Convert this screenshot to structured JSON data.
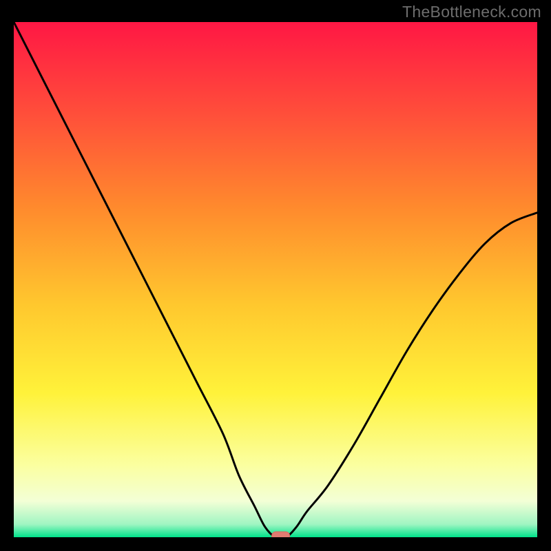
{
  "watermark": "TheBottleneck.com",
  "colors": {
    "bg": "#000000",
    "line": "#000000",
    "marker_fill": "#e07b71",
    "marker_stroke": "#d56a60",
    "watermark": "#6d6d6d",
    "gradient_top": "#ff1744",
    "gradient_upper": "#ff4f3a",
    "gradient_mid_up": "#ff8a2d",
    "gradient_mid": "#ffc82e",
    "gradient_mid_low": "#fff23a",
    "gradient_low": "#fbffa0",
    "gradient_band": "#f3ffd6",
    "gradient_green": "#00e38a"
  },
  "chart_data": {
    "type": "line",
    "title": "",
    "xlabel": "",
    "ylabel": "",
    "xlim": [
      0,
      100
    ],
    "ylim": [
      0,
      100
    ],
    "series": [
      {
        "name": "bottleneck-curve",
        "x": [
          0,
          5,
          10,
          15,
          20,
          25,
          30,
          35,
          40,
          43,
          46,
          48,
          50,
          52,
          54,
          56,
          60,
          65,
          70,
          75,
          80,
          85,
          90,
          95,
          100
        ],
        "values": [
          100,
          90,
          80,
          70,
          60,
          50,
          40,
          30,
          20,
          12,
          6,
          2,
          0,
          0,
          2,
          5,
          10,
          18,
          27,
          36,
          44,
          51,
          57,
          61,
          63
        ]
      }
    ],
    "marker": {
      "x": 51,
      "y": 0
    },
    "gradient_stops": [
      {
        "pos": 0.0,
        "color": "#ff1744"
      },
      {
        "pos": 0.18,
        "color": "#ff4f3a"
      },
      {
        "pos": 0.36,
        "color": "#ff8a2d"
      },
      {
        "pos": 0.55,
        "color": "#ffc82e"
      },
      {
        "pos": 0.72,
        "color": "#fff23a"
      },
      {
        "pos": 0.86,
        "color": "#fbffa0"
      },
      {
        "pos": 0.93,
        "color": "#f3ffd6"
      },
      {
        "pos": 0.975,
        "color": "#9ff5c2"
      },
      {
        "pos": 1.0,
        "color": "#00e38a"
      }
    ]
  }
}
